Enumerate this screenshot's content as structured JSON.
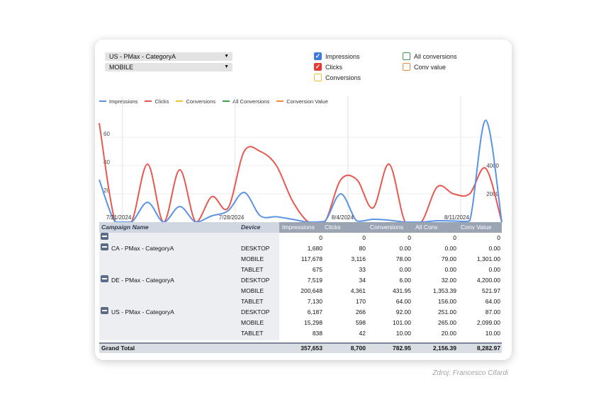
{
  "filters": {
    "campaign_select": "US - PMax - CategoryA",
    "device_select": "MOBILE"
  },
  "metric_toggles": [
    {
      "label": "Impressions",
      "checked": true,
      "color": "#3d7be0"
    },
    {
      "label": "Clicks",
      "checked": true,
      "color": "#e53a32"
    },
    {
      "label": "Conversions",
      "checked": false,
      "color": "#f2c230"
    },
    {
      "label": "All conversions",
      "checked": false,
      "color": "#3a9a4a"
    },
    {
      "label": "Conv value",
      "checked": false,
      "color": "#ef8a3a"
    }
  ],
  "chart_data": {
    "type": "line",
    "legend": [
      {
        "name": "Impressions",
        "color": "#5b93e6"
      },
      {
        "name": "Clicks",
        "color": "#e8584f"
      },
      {
        "name": "Conversions",
        "color": "#f2c230"
      },
      {
        "name": "All Conversions",
        "color": "#3aa14c"
      },
      {
        "name": "Conversion Value",
        "color": "#ef8a3a"
      }
    ],
    "x_tick_labels": [
      "7/21/2024",
      "7/28/2024",
      "8/4/2024",
      "8/11/2024"
    ],
    "x_tick_index": [
      1,
      8,
      15,
      22
    ],
    "left_axis_ticks": [
      "20",
      "40",
      "60"
    ],
    "right_axis_ticks": [
      "2000",
      "4000"
    ],
    "left_ylim": [
      0,
      80
    ],
    "right_ylim": [
      0,
      8000
    ],
    "series": [
      {
        "name": "Clicks",
        "axis": "left",
        "values": [
          70,
          0,
          0,
          41,
          0,
          37,
          0,
          18,
          10,
          50,
          50,
          40,
          15,
          0,
          0,
          30,
          30,
          10,
          41,
          0,
          0,
          25,
          20,
          20,
          38,
          0
        ]
      },
      {
        "name": "Impressions",
        "axis": "right",
        "values": [
          3000,
          0,
          0,
          1400,
          0,
          1100,
          0,
          450,
          800,
          2100,
          450,
          380,
          200,
          0,
          50,
          2000,
          80,
          200,
          140,
          0,
          0,
          100,
          80,
          80,
          7200,
          0
        ]
      }
    ]
  },
  "table": {
    "columns": [
      "Campaign Name",
      "Device",
      "Impressions",
      "Clicks",
      "Conversions",
      "All Conv",
      "Conv Value"
    ],
    "rows": [
      {
        "campaign": "",
        "device": "",
        "values": [
          "0",
          "0",
          "0",
          "0",
          "0"
        ],
        "toggle": true
      },
      {
        "campaign": "CA - PMax - CategoryA",
        "device": "DESKTOP",
        "values": [
          "1,680",
          "80",
          "0.00",
          "0.00",
          "0.00"
        ],
        "toggle": true
      },
      {
        "campaign": "",
        "device": "MOBILE",
        "values": [
          "117,678",
          "3,116",
          "78.00",
          "79.00",
          "1,301.00"
        ]
      },
      {
        "campaign": "",
        "device": "TABLET",
        "values": [
          "675",
          "33",
          "0.00",
          "0.00",
          "0.00"
        ]
      },
      {
        "campaign": "DE - PMax - CategoryA",
        "device": "DESKTOP",
        "values": [
          "7,519",
          "34",
          "6.00",
          "32.00",
          "4,200.00"
        ],
        "toggle": true
      },
      {
        "campaign": "",
        "device": "MOBILE",
        "values": [
          "200,648",
          "4,361",
          "431.95",
          "1,353.39",
          "521.97"
        ]
      },
      {
        "campaign": "",
        "device": "TABLET",
        "values": [
          "7,130",
          "170",
          "64.00",
          "156.00",
          "64.00"
        ]
      },
      {
        "campaign": "US - PMax - CategoryA",
        "device": "DESKTOP",
        "values": [
          "6,187",
          "266",
          "92.00",
          "251.00",
          "87.00"
        ],
        "toggle": true
      },
      {
        "campaign": "",
        "device": "MOBILE",
        "values": [
          "15,298",
          "598",
          "101.00",
          "265.00",
          "2,099.00"
        ]
      },
      {
        "campaign": "",
        "device": "TABLET",
        "values": [
          "838",
          "42",
          "10.00",
          "20.00",
          "10.00"
        ]
      }
    ],
    "grand_total": {
      "label": "Grand Total",
      "values": [
        "357,653",
        "8,700",
        "782.95",
        "2,156.39",
        "8,282.97"
      ]
    }
  },
  "source_caption": "Zdroj: Francesco Cifardi"
}
